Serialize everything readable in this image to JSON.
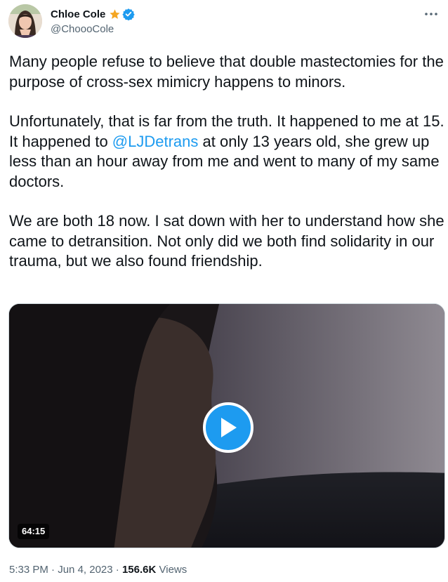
{
  "author": {
    "display_name": "Chloe Cole",
    "handle": "@ChoooCole",
    "star_color": "#f4a623",
    "verified_color": "#1d9bf0"
  },
  "tweet": {
    "paragraphs": [
      {
        "parts": [
          {
            "text": "Many people refuse to believe that double mastectomies for the purpose of cross-sex mimicry happens to minors."
          }
        ]
      },
      {
        "parts": [
          {
            "text": "Unfortunately, that is far from the truth. It happened to me at 15. It happened to "
          },
          {
            "text": "@LJDetrans",
            "mention": true
          },
          {
            "text": " at only 13 years old, she grew up less than an hour away from me and went to many of my same doctors."
          }
        ]
      },
      {
        "parts": [
          {
            "text": "We are both 18 now. I sat down with her to understand how she came to detransition. Not only did we both find solidarity in our trauma, but we also found friendship."
          }
        ]
      }
    ]
  },
  "media": {
    "duration": "64:15",
    "play_icon": "play-icon"
  },
  "meta": {
    "time": "5:33 PM",
    "separator": "·",
    "date": "Jun 4, 2023",
    "views_count": "156.6K",
    "views_label": "Views"
  },
  "colors": {
    "link": "#1d9bf0",
    "text": "#0f1419",
    "secondary": "#536471"
  }
}
